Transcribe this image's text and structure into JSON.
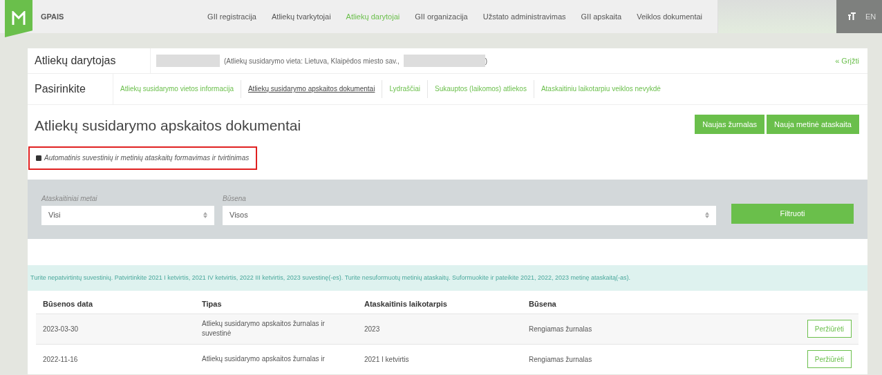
{
  "app": {
    "name": "GPAIS"
  },
  "nav": [
    {
      "label": "GII registracija",
      "selected": false
    },
    {
      "label": "Atliekų tvarkytojai",
      "selected": false
    },
    {
      "label": "Atliekų darytojai",
      "selected": true
    },
    {
      "label": "GII organizacija",
      "selected": false
    },
    {
      "label": "Užstato administravimas",
      "selected": false
    },
    {
      "label": "GII apskaita",
      "selected": false
    },
    {
      "label": "Veiklos dokumentai",
      "selected": false
    }
  ],
  "language": "EN",
  "producer": {
    "label": "Atliekų darytojas",
    "location_prefix": "(Atliekų susidarymo vieta: Lietuva, Klaipėdos miesto sav.,",
    "location_suffix": ")",
    "back_link": "« Grįžti"
  },
  "section_tabs": {
    "label": "Pasirinkite",
    "tabs": [
      {
        "label": "Atliekų susidarymo vietos informacija",
        "selected": false
      },
      {
        "label": "Atliekų susidarymo apskaitos dokumentai",
        "selected": true
      },
      {
        "label": "Lydraščiai",
        "selected": false
      },
      {
        "label": "Sukauptos (laikomos) atliekos",
        "selected": false
      },
      {
        "label": "Ataskaitiniu laikotarpiu veiklos nevykdė",
        "selected": false
      }
    ]
  },
  "page_title": "Atliekų susidarymo apskaitos dokumentai",
  "actions": [
    "Naujas žurnalas",
    "Nauja metinė ataskaita"
  ],
  "auto_option": {
    "label": "Automatinis suvestinių ir metinių ataskaitų formavimas ir tvirtinimas",
    "checked": true
  },
  "filters": [
    {
      "label": "Ataskaitiniai metai",
      "value": "Visi"
    },
    {
      "label": "Būsena",
      "value": "Visos"
    }
  ],
  "filter_button": "Filtruoti",
  "notice": "Turite nepatvirtintų suvestinių. Patvirtinkite 2021 I ketvirtis, 2021 IV ketvirtis, 2022 III ketvirtis, 2023 suvestinę(-es). Turite nesuformuotų metinių ataskaitų. Suformuokite ir pateikite 2021, 2022, 2023 metinę ataskaitą(-as).",
  "table": {
    "columns": [
      "Būsenos data",
      "Tipas",
      "Ataskaitinis laikotarpis",
      "Būsena"
    ],
    "rows": [
      {
        "date": "2023-03-30",
        "type": "Atliekų susidarymo apskaitos žurnalas ir suvestinė",
        "period": "2023",
        "status": "Rengiamas žurnalas",
        "action": "Peržiūrėti"
      },
      {
        "date": "2022-11-16",
        "type": "Atliekų susidarymo apskaitos žurnalas ir",
        "period": "2021 I ketvirtis",
        "status": "Rengiamas žurnalas",
        "action": "Peržiūrėti"
      }
    ]
  }
}
